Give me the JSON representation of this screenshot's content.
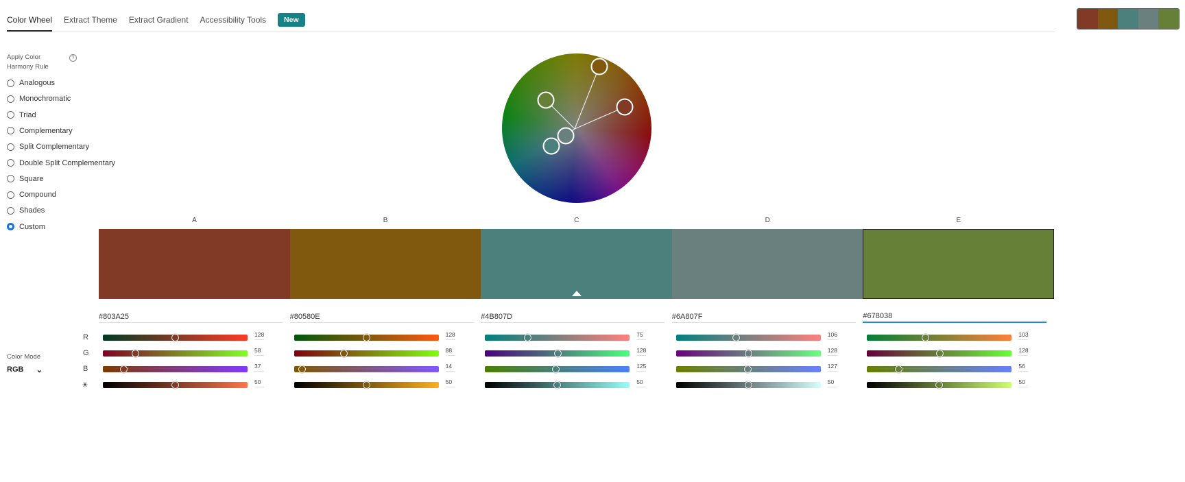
{
  "tabs": [
    {
      "label": "Color Wheel",
      "active": true
    },
    {
      "label": "Extract Theme"
    },
    {
      "label": "Extract Gradient"
    },
    {
      "label": "Accessibility Tools"
    }
  ],
  "tabs_badge": "New",
  "harmony": {
    "label": "Apply Color Harmony Rule",
    "help_icon": "?",
    "selected": "Custom",
    "options": [
      "Analogous",
      "Monochromatic",
      "Triad",
      "Complementary",
      "Split Complementary",
      "Double Split Complementary",
      "Square",
      "Compound",
      "Shades",
      "Custom"
    ]
  },
  "color_mode": {
    "label": "Color Mode",
    "value": "RGB",
    "icon": "chevron-down-icon"
  },
  "row_labels": [
    "R",
    "G",
    "B"
  ],
  "brightness_icon": "sun-icon",
  "selected_swatch": "E",
  "base_swatch": "C",
  "swatches": [
    {
      "letter": "A",
      "hex": "#803A25",
      "rgb": [
        128,
        58,
        37
      ],
      "brightness": 50
    },
    {
      "letter": "B",
      "hex": "#80580E",
      "rgb": [
        128,
        88,
        14
      ],
      "brightness": 50
    },
    {
      "letter": "C",
      "hex": "#4B807D",
      "rgb": [
        75,
        128,
        125
      ],
      "brightness": 50
    },
    {
      "letter": "D",
      "hex": "#6A807F",
      "rgb": [
        106,
        128,
        127
      ],
      "brightness": 50
    },
    {
      "letter": "E",
      "hex": "#678038",
      "rgb": [
        103,
        128,
        56
      ],
      "brightness": 50
    }
  ]
}
